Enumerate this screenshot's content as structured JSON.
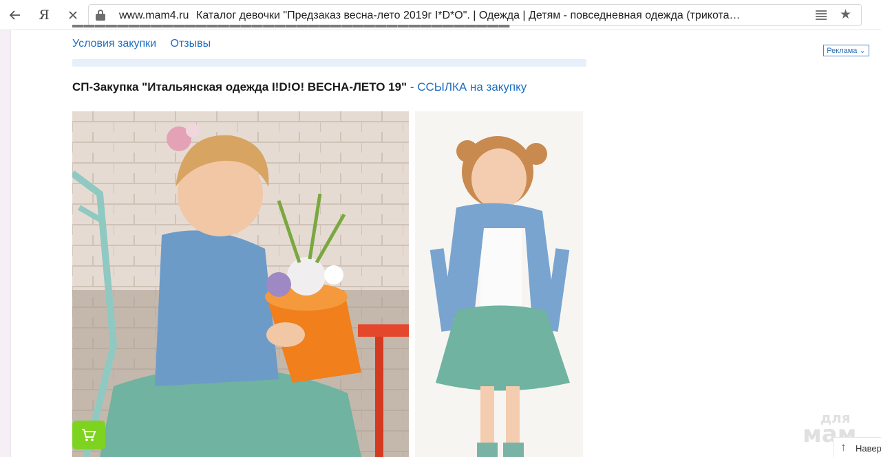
{
  "browser": {
    "back_icon": "arrow-left-icon",
    "yandex_label": "Я",
    "stop_icon": "close-icon",
    "url_host": "www.mam4.ru",
    "page_title": "Каталог девочки \"Предзаказ весна-лето 2019г I*D*O\". | Одежда | Детям - повседневная одежда (трикотаж, ни...",
    "reader_icon": "reader-mode-icon",
    "bookmark_icon": "star-icon"
  },
  "page": {
    "links": [
      "Условия закупки",
      "Отзывы"
    ],
    "headline_bold": "СП-Закупка \"Итальянская одежда I!D!O! ВЕСНА-ЛЕТО 19\"",
    "headline_link": "- ССЫЛКА на закупку",
    "ad_label": "Реклама",
    "cart_icon": "shopping-cart-icon",
    "watermark_top": "для",
    "watermark_bottom": "мам",
    "to_top_label": "Навер"
  },
  "colors": {
    "link": "#1f6fc4",
    "cart_button": "#7ed321",
    "info_strip": "#e6effa"
  }
}
